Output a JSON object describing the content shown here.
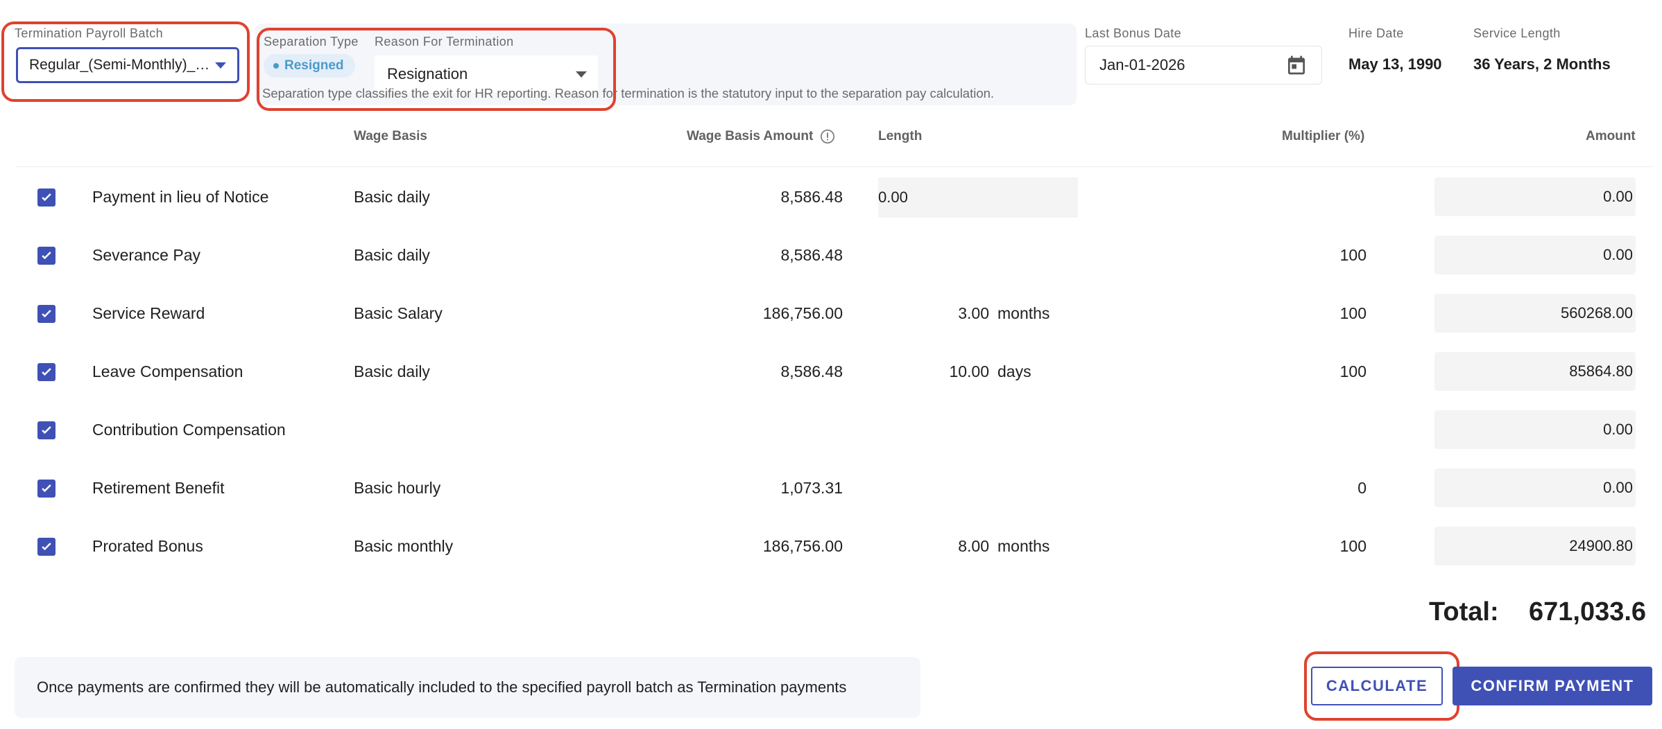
{
  "header": {
    "payroll_batch_label": "Termination Payroll Batch",
    "payroll_batch_value": "Regular_(Semi-Monthly)_(...",
    "separation_type_label": "Separation Type",
    "separation_type_value": "Resigned",
    "reason_label": "Reason For Termination",
    "reason_value": "Resignation",
    "helper_text": "Separation type classifies the exit for HR reporting. Reason for termination is the statutory input to the separation pay calculation.",
    "last_bonus_label": "Last Bonus Date",
    "last_bonus_value": "Jan-01-2026",
    "hire_date_label": "Hire Date",
    "hire_date_value": "May 13, 1990",
    "service_length_label": "Service Length",
    "service_length_value": "36 Years, 2 Months"
  },
  "table": {
    "columns": {
      "wage_basis": "Wage Basis",
      "wage_basis_amount": "Wage Basis Amount",
      "length": "Length",
      "multiplier": "Multiplier (%)",
      "amount": "Amount"
    },
    "rows": [
      {
        "name": "Payment in lieu of Notice",
        "basis": "Basic daily",
        "wba": "8,586.48",
        "length": "0.00",
        "unit": "",
        "mult": "",
        "amount": "0.00"
      },
      {
        "name": "Severance Pay",
        "basis": "Basic daily",
        "wba": "8,586.48",
        "length": "",
        "unit": "",
        "mult": "100",
        "amount": "0.00"
      },
      {
        "name": "Service Reward",
        "basis": "Basic Salary",
        "wba": "186,756.00",
        "length": "3.00",
        "unit": "months",
        "mult": "100",
        "amount": "560268.00"
      },
      {
        "name": "Leave Compensation",
        "basis": "Basic daily",
        "wba": "8,586.48",
        "length": "10.00",
        "unit": "days",
        "mult": "100",
        "amount": "85864.80"
      },
      {
        "name": "Contribution Compensation",
        "basis": "",
        "wba": "",
        "length": "",
        "unit": "",
        "mult": "",
        "amount": "0.00"
      },
      {
        "name": "Retirement Benefit",
        "basis": "Basic hourly",
        "wba": "1,073.31",
        "length": "",
        "unit": "",
        "mult": "0",
        "amount": "0.00"
      },
      {
        "name": "Prorated Bonus",
        "basis": "Basic monthly",
        "wba": "186,756.00",
        "length": "8.00",
        "unit": "months",
        "mult": "100",
        "amount": "24900.80"
      }
    ]
  },
  "total": {
    "label": "Total:",
    "value": "671,033.6"
  },
  "footer": {
    "notice": "Once payments are confirmed they will be automatically included to the specified payroll batch as Termination payments",
    "calculate_label": "CALCULATE",
    "confirm_label": "CONFIRM PAYMENT"
  },
  "colors": {
    "primary": "#3f51b5",
    "highlight": "#e0422f",
    "chip_text": "#4a9bcb"
  }
}
